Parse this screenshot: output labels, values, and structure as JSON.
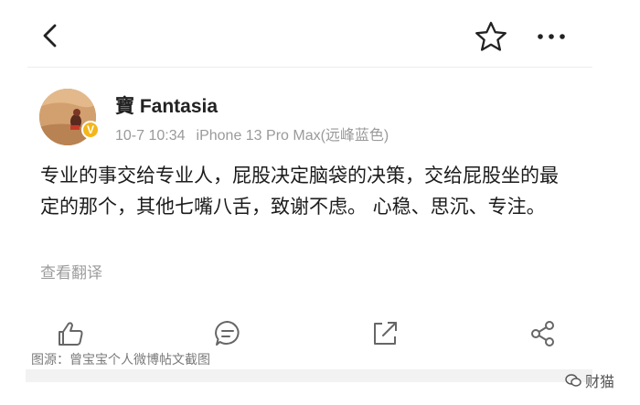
{
  "post": {
    "username": "寶 Fantasia",
    "date": "10-7 10:34",
    "device": "iPhone 13 Pro Max(远峰蓝色)",
    "verified_badge": "V",
    "content": "专业的事交给专业人，屁股决定脑袋的决策，交给屁股坐的最定的那个，其他七嘴八舌，致谢不虑。 心稳、思沉、专注。",
    "translate_label": "查看翻译"
  },
  "icons": {
    "back": "chevron-left-icon",
    "favorite": "star-icon",
    "more": "more-horizontal-icon",
    "like": "thumbs-up-icon",
    "comment": "comment-icon",
    "repost": "share-arrow-icon",
    "share": "share-nodes-icon"
  },
  "caption": "图源：曾宝宝个人微博帖文截图",
  "watermark": "财猫",
  "colors": {
    "badge": "#f3b61b",
    "meta": "#9a9a9a",
    "translate": "#9c9c9c"
  }
}
